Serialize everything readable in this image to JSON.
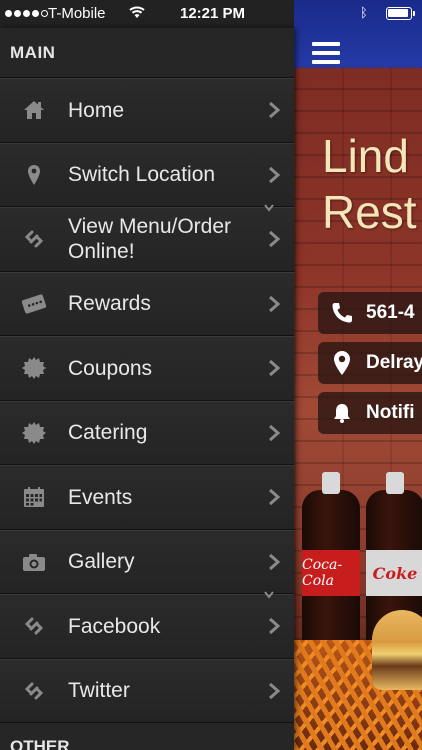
{
  "status_bar": {
    "carrier": "T-Mobile",
    "time": "12:21 PM"
  },
  "side_menu": {
    "main_header": "MAIN",
    "other_header": "OTHER",
    "items": [
      {
        "label": "Home",
        "icon": "home-icon"
      },
      {
        "label": "Switch Location",
        "icon": "location-pin-icon"
      },
      {
        "label": "View Menu/Order Online!",
        "icon": "link-icon"
      },
      {
        "label": "Rewards",
        "icon": "rewards-card-icon"
      },
      {
        "label": "Coupons",
        "icon": "coupon-badge-icon"
      },
      {
        "label": "Catering",
        "icon": "catering-badge-icon"
      },
      {
        "label": "Events",
        "icon": "calendar-icon"
      },
      {
        "label": "Gallery",
        "icon": "camera-icon"
      },
      {
        "label": "Facebook",
        "icon": "link-icon"
      },
      {
        "label": "Twitter",
        "icon": "link-icon"
      }
    ]
  },
  "main": {
    "title_line1": "Lind",
    "title_line2": "Rest",
    "phone": "561-4",
    "location": "Delray",
    "notifications": "Notifi",
    "bottle1_label": "Coca-Cola",
    "bottle2_label": "Coke"
  },
  "colors": {
    "menu_bg": "#232323",
    "top_bar_blue": "#243aa6",
    "title_cream": "#f4e6b8"
  }
}
